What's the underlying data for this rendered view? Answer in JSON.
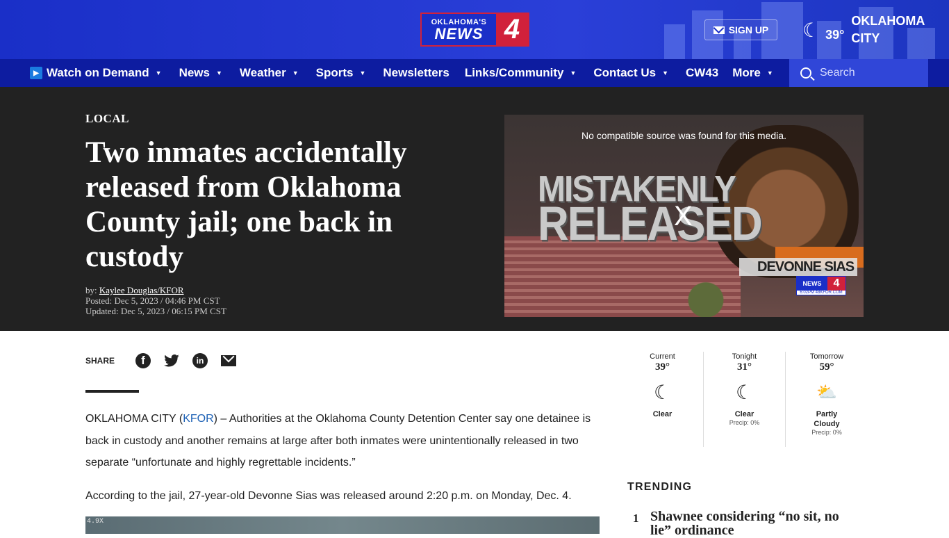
{
  "header": {
    "logo_top": "OKLAHOMA'S",
    "logo_main": "NEWS",
    "logo_num": "4",
    "signup_label": "SIGN UP",
    "weather_temp": "39°",
    "city_line1": "OKLAHOMA",
    "city_line2": "CITY"
  },
  "nav": {
    "items": [
      {
        "label": "Watch on Demand",
        "dropdown": true
      },
      {
        "label": "News",
        "dropdown": true
      },
      {
        "label": "Weather",
        "dropdown": true
      },
      {
        "label": "Sports",
        "dropdown": true
      },
      {
        "label": "Newsletters",
        "dropdown": false
      },
      {
        "label": "Links/Community",
        "dropdown": true
      },
      {
        "label": "Contact Us",
        "dropdown": true
      },
      {
        "label": "CW43",
        "dropdown": false
      },
      {
        "label": "More",
        "dropdown": true
      }
    ],
    "search_placeholder": "Search"
  },
  "article": {
    "category": "LOCAL",
    "headline": "Two inmates accidentally released from Oklahoma County jail; one back in custody",
    "by_prefix": "by: ",
    "author": "Kaylee Douglas/KFOR",
    "posted": "Posted: Dec 5, 2023 / 04:46 PM CST",
    "updated": "Updated: Dec 5, 2023 / 06:15 PM CST",
    "share_label": "SHARE",
    "p1_start": "OKLAHOMA CITY (",
    "p1_link": "KFOR",
    "p1_rest": ") – Authorities at the Oklahoma County Detention Center say one detainee is back in custody and another remains at large after both inmates were unintentionally released in two separate “unfortunate and highly regrettable incidents.”",
    "p2": "According to the jail, 27-year-old Devonne Sias was released around 2:20 p.m. on Monday, Dec. 4.",
    "image_tag": "4.9X"
  },
  "video": {
    "error_msg": "No compatible source was found for this media.",
    "title_line1": "MISTAKENLY",
    "title_line2": "RELEASED",
    "close_label": "X",
    "name_tag": "DEVONNE SIAS",
    "logo_left": "NEWS",
    "logo_right": "4",
    "logo_small": "6:02PM 48KFOR.COM"
  },
  "weather_widget": [
    {
      "label": "Current",
      "temp": "39°",
      "icon": "moon-icon",
      "cond": "Clear",
      "precip": ""
    },
    {
      "label": "Tonight",
      "temp": "31°",
      "icon": "moon-icon",
      "cond": "Clear",
      "precip": "Precip: 0%"
    },
    {
      "label": "Tomorrow",
      "temp": "59°",
      "icon": "partly-cloudy-icon",
      "cond": "Partly Cloudy",
      "precip": "Precip: 0%"
    }
  ],
  "trending": {
    "heading": "TRENDING",
    "items": [
      {
        "num": "1",
        "title": "Shawnee considering “no sit, no lie” ordinance"
      }
    ]
  },
  "colors": {
    "header_blue": "#1a2fc8",
    "nav_blue": "#0d1ca0",
    "brand_red": "#d1213b",
    "hero_bg": "#222222"
  }
}
